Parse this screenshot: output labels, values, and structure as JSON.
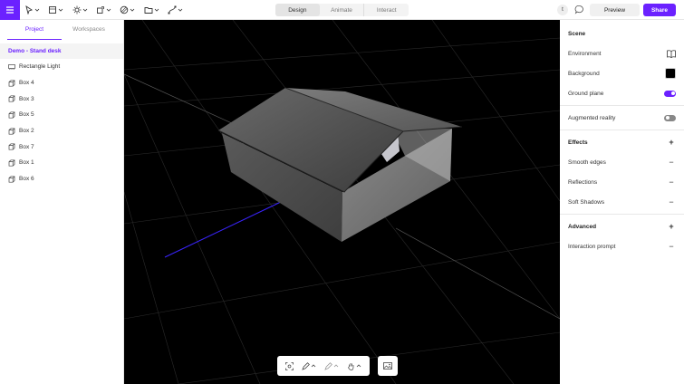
{
  "toolbar": {
    "tools": [
      "cursor-icon",
      "shapes-icon",
      "light-icon",
      "object-icon",
      "material-icon",
      "folder-icon",
      "path-icon"
    ]
  },
  "mode_tabs": [
    {
      "label": "Design",
      "active": true
    },
    {
      "label": "Animate",
      "active": false
    },
    {
      "label": "Interact",
      "active": false
    }
  ],
  "header": {
    "avatar_initial": "t",
    "preview_label": "Preview",
    "share_label": "Share"
  },
  "left_panel": {
    "tabs": [
      {
        "label": "Project",
        "active": true
      },
      {
        "label": "Workspaces",
        "active": false
      }
    ],
    "scene_root": "Demo - Stand desk",
    "objects": [
      {
        "label": "Rectangle Light",
        "icon": "light-icon"
      },
      {
        "label": "Box 4",
        "icon": "box-icon"
      },
      {
        "label": "Box 3",
        "icon": "box-icon"
      },
      {
        "label": "Box 5",
        "icon": "box-icon"
      },
      {
        "label": "Box 2",
        "icon": "box-icon"
      },
      {
        "label": "Box 7",
        "icon": "box-icon"
      },
      {
        "label": "Box 1",
        "icon": "box-icon"
      },
      {
        "label": "Box 6",
        "icon": "box-icon"
      }
    ]
  },
  "right_panel": {
    "scene_title": "Scene",
    "environment_label": "Environment",
    "background_label": "Background",
    "background_color": "#000000",
    "ground_plane_label": "Ground plane",
    "ground_plane_on": true,
    "ar_label": "Augmented reality",
    "ar_on": false,
    "effects_title": "Effects",
    "effects": [
      "Smooth edges",
      "Reflections",
      "Soft Shadows"
    ],
    "advanced_title": "Advanced",
    "advanced": [
      "Interaction prompt"
    ]
  },
  "colors": {
    "accent": "#6b21ff",
    "viewport_bg": "#000000"
  }
}
